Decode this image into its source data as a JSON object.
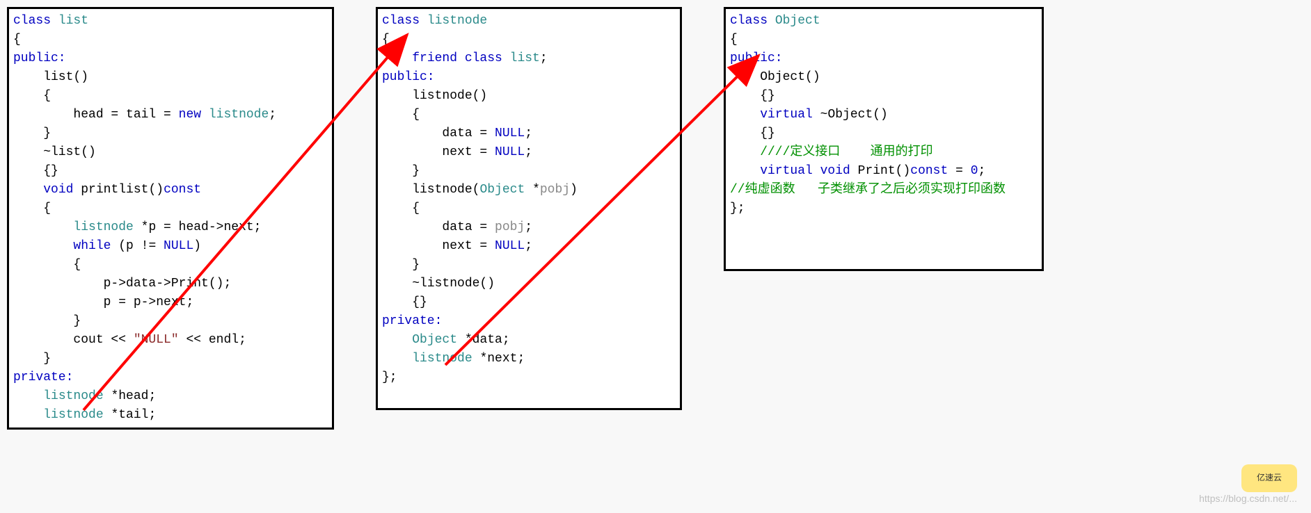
{
  "panel1": {
    "l1a": "class ",
    "l1b": "list",
    "l2": "{",
    "l3": "public:",
    "l4": "    list()",
    "l5": "    {",
    "l6a": "        head = tail = ",
    "l6b": "new ",
    "l6c": "listnode",
    ";l6d": ";",
    "l7": "    }",
    "l8a": "    ~list()",
    "l9": "    {}",
    "l10a": "    ",
    "l10b": "void ",
    "l10c": "printlist()",
    "l10d": "const",
    "l11": "    {",
    "l12a": "        ",
    "l12b": "listnode ",
    "l12c": "*p = head->next;",
    "l13a": "        ",
    "l13b": "while ",
    "l13c": "(p != ",
    "l13d": "NULL",
    "l13e": ")",
    "l14": "        {",
    "l15": "            p->data->Print();",
    "l16": "            p = p->next;",
    "l17": "        }",
    "l18a": "        cout << ",
    "l18b": "\"NULL\" ",
    "l18c": "<< endl;",
    "l19": "    }",
    "l20": "private:",
    "l21a": "    ",
    "l21b": "listnode ",
    "l21c": "*head;",
    "l22a": "    ",
    "l22b": "listnode ",
    "l22c": "*tail;"
  },
  "panel2": {
    "l1a": "class ",
    "l1b": "listnode",
    "l2": "{",
    "l3a": "    ",
    "l3b": "friend class ",
    "l3c": "list",
    ";l3d": ";",
    "l4": "public:",
    "l5": "    listnode()",
    "l6": "    {",
    "l7a": "        data = ",
    "l7b": "NULL",
    "l7c": ";",
    "l8a": "        next = ",
    "l8b": "NULL",
    "l8c": ";",
    "l9": "    }",
    "l10a": "    listnode(",
    "l10b": "Object ",
    "l10c": "*",
    "l10d": "pobj",
    "l10e": ")",
    "l11": "    {",
    "l12a": "        data = ",
    "l12b": "pobj",
    "l12c": ";",
    "l13a": "        next = ",
    "l13b": "NULL",
    "l13c": ";",
    "l14": "    }",
    "l15": "    ~listnode()",
    "l16": "    {}",
    "l17": "private:",
    "l18a": "    ",
    "l18b": "Object ",
    "l18c": "*data;",
    "l19a": "    ",
    "l19b": "listnode ",
    "l19c": "*next;",
    "l20": "};"
  },
  "panel3": {
    "l1a": "class ",
    "l1b": "Object",
    "l2": "{",
    "l3": "public:",
    "l4": "    Object()",
    "l5": "    {}",
    "l6a": "    ",
    "l6b": "virtual ",
    "l6c": "~Object()",
    "l7": "    {}",
    "l8": "    ////定义接口    通用的打印",
    "l9a": "    ",
    "l9b": "virtual void ",
    "l9c": "Print()",
    "l9d": "const ",
    "l9e": "= ",
    "l9f": "0",
    "l9g": ";",
    "l10": "//纯虚函数   子类继承了之后必须实现打印函数",
    "l11": "};"
  },
  "watermark": "https://blog.csdn.net/...",
  "badge": "亿速云"
}
